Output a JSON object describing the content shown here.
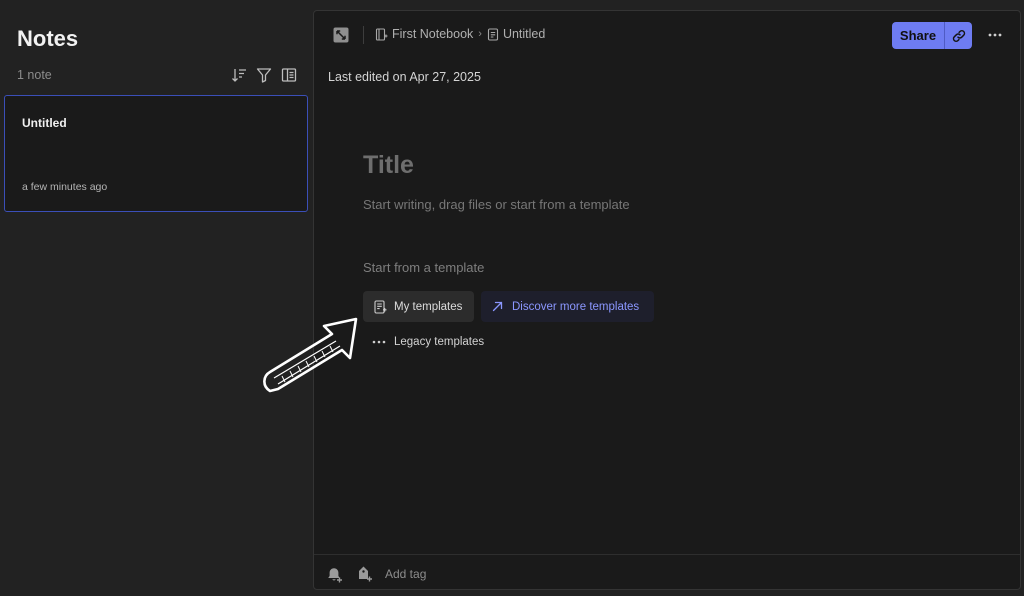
{
  "sidebar": {
    "title": "Notes",
    "count": "1 note",
    "tools": [
      "sort-icon",
      "filter-icon",
      "view-toggle-icon"
    ],
    "notes": [
      {
        "title": "Untitled",
        "time": "a few minutes ago"
      }
    ]
  },
  "editor": {
    "breadcrumb": {
      "notebook": "First Notebook",
      "note": "Untitled"
    },
    "share_label": "Share",
    "last_edited": "Last edited on Apr 27, 2025",
    "title_placeholder": "Title",
    "body_placeholder": "Start writing, drag files or start from a template",
    "template_label": "Start from a template",
    "my_templates": "My templates",
    "discover_templates": "Discover more templates",
    "legacy_templates": "Legacy templates",
    "add_tag_placeholder": "Add tag"
  },
  "colors": {
    "accent": "#6e7cf2",
    "link_text": "#8b97ff",
    "card_border": "#3b4fb8",
    "background": "#222222",
    "editor_background": "#1a1a1a"
  }
}
